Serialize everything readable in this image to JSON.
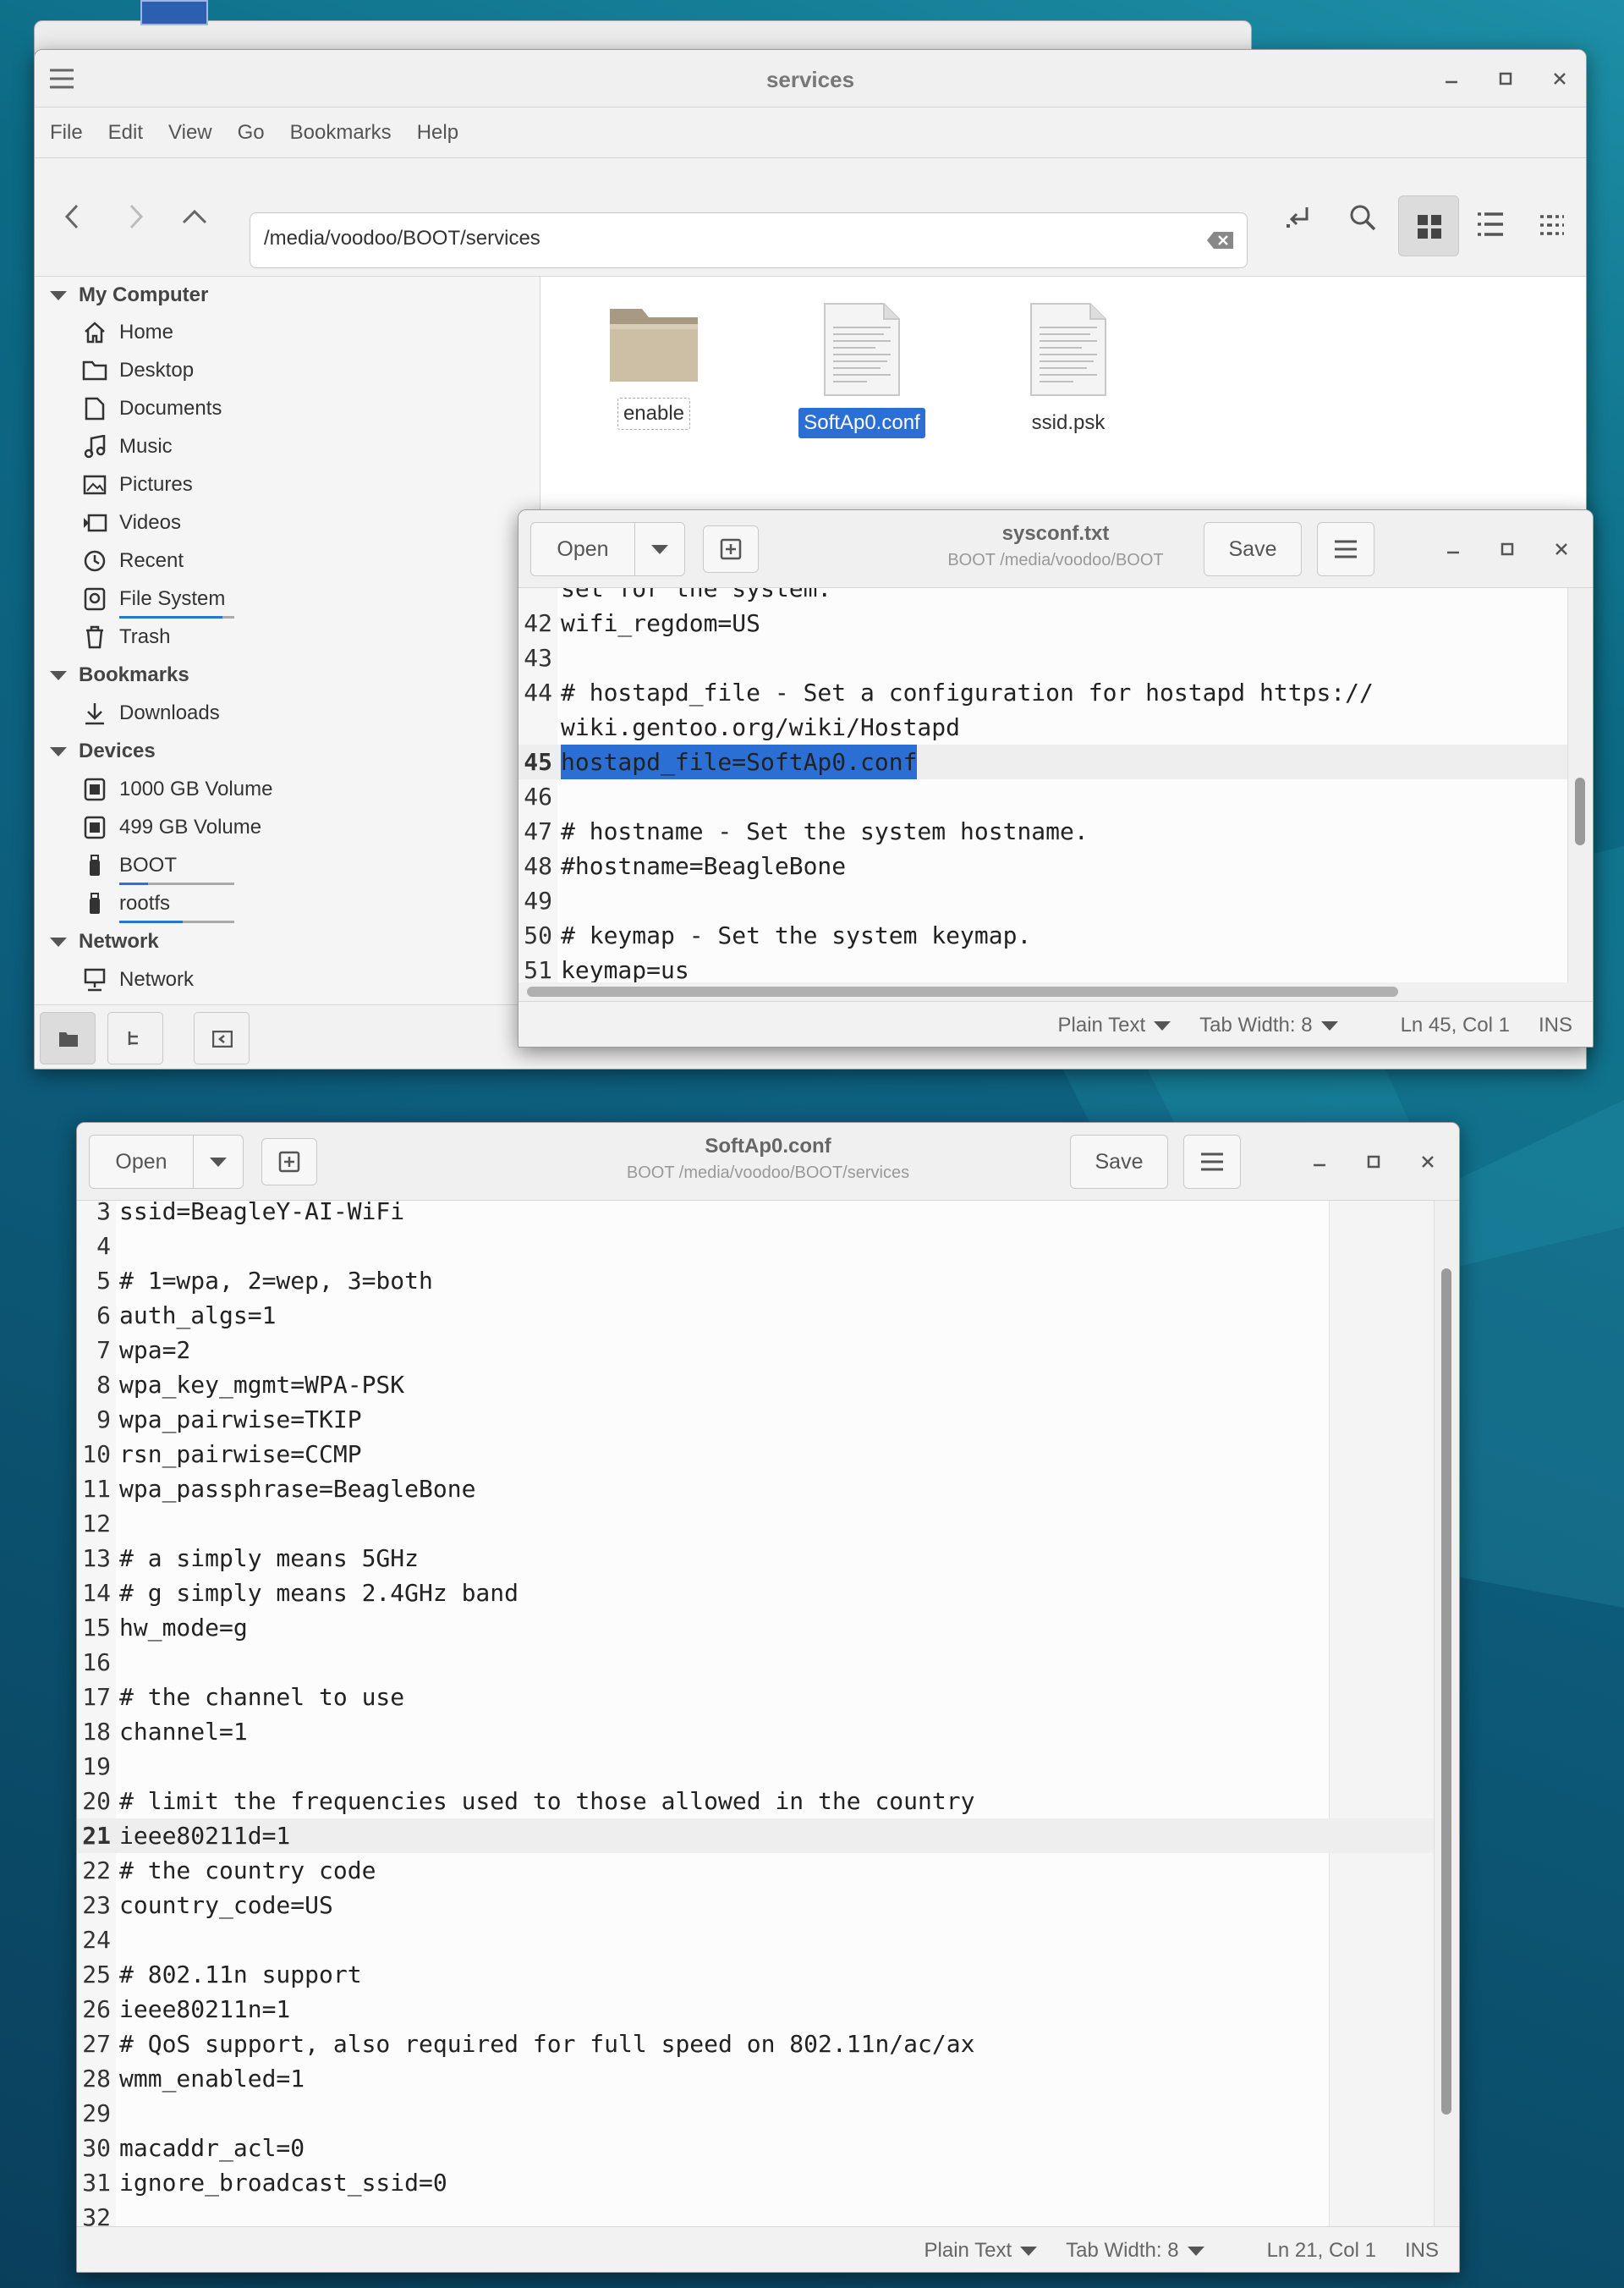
{
  "colors": {
    "accent": "#2b6fd4",
    "desktop": "#0d5f7e"
  },
  "file_manager": {
    "title": "services",
    "menu": [
      "File",
      "Edit",
      "View",
      "Go",
      "Bookmarks",
      "Help"
    ],
    "location": "/media/voodoo/BOOT/services",
    "sidebar": {
      "sections": [
        {
          "label": "My Computer",
          "items": [
            {
              "label": "Home",
              "icon": "home-icon"
            },
            {
              "label": "Desktop",
              "icon": "folder-icon"
            },
            {
              "label": "Documents",
              "icon": "document-icon"
            },
            {
              "label": "Music",
              "icon": "music-icon"
            },
            {
              "label": "Pictures",
              "icon": "picture-icon"
            },
            {
              "label": "Videos",
              "icon": "video-icon"
            },
            {
              "label": "Recent",
              "icon": "clock-icon"
            },
            {
              "label": "File System",
              "icon": "drive-icon",
              "usage": 0.9
            },
            {
              "label": "Trash",
              "icon": "trash-icon"
            }
          ]
        },
        {
          "label": "Bookmarks",
          "items": [
            {
              "label": "Downloads",
              "icon": "download-icon"
            }
          ]
        },
        {
          "label": "Devices",
          "items": [
            {
              "label": "1000 GB Volume",
              "icon": "drive-icon"
            },
            {
              "label": "499 GB Volume",
              "icon": "drive-icon"
            },
            {
              "label": "BOOT",
              "icon": "usb-icon",
              "usage": 0.25
            },
            {
              "label": "rootfs",
              "icon": "usb-icon",
              "usage": 0.55
            }
          ]
        },
        {
          "label": "Network",
          "items": [
            {
              "label": "Network",
              "icon": "network-icon"
            }
          ]
        }
      ]
    },
    "files": [
      {
        "name": "enable",
        "type": "folder"
      },
      {
        "name": "SoftAp0.conf",
        "type": "text",
        "selected": true
      },
      {
        "name": "ssid.psk",
        "type": "text"
      }
    ]
  },
  "sysconf_editor": {
    "title": "sysconf.txt",
    "subtitle": "BOOT /media/voodoo/BOOT",
    "open_label": "Open",
    "save_label": "Save",
    "partial_top": "set for the system.",
    "lines": [
      {
        "n": "42",
        "t": "wifi_regdom=US"
      },
      {
        "n": "43",
        "t": ""
      },
      {
        "n": "44",
        "t": "# hostapd_file - Set a configuration for hostapd https://"
      },
      {
        "n": "",
        "t": "wiki.gentoo.org/wiki/Hostapd"
      },
      {
        "n": "45",
        "t": "hostapd_file=SoftAp0.conf",
        "current": true,
        "selected": true
      },
      {
        "n": "46",
        "t": ""
      },
      {
        "n": "47",
        "t": "# hostname - Set the system hostname."
      },
      {
        "n": "48",
        "t": "#hostname=BeagleBone"
      },
      {
        "n": "49",
        "t": ""
      },
      {
        "n": "50",
        "t": "# keymap - Set the system keymap."
      },
      {
        "n": "51",
        "t": "keymap=us"
      }
    ],
    "status": {
      "syntax": "Plain Text",
      "tab_width": "Tab Width: 8",
      "position": "Ln 45, Col 1",
      "mode": "INS"
    }
  },
  "softap_editor": {
    "title": "SoftAp0.conf",
    "subtitle": "BOOT /media/voodoo/BOOT/services",
    "open_label": "Open",
    "save_label": "Save",
    "lines": [
      {
        "n": "3",
        "t": "ssid=BeagleY-AI-WiFi"
      },
      {
        "n": "4",
        "t": ""
      },
      {
        "n": "5",
        "t": "# 1=wpa, 2=wep, 3=both"
      },
      {
        "n": "6",
        "t": "auth_algs=1"
      },
      {
        "n": "7",
        "t": "wpa=2"
      },
      {
        "n": "8",
        "t": "wpa_key_mgmt=WPA-PSK"
      },
      {
        "n": "9",
        "t": "wpa_pairwise=TKIP"
      },
      {
        "n": "10",
        "t": "rsn_pairwise=CCMP"
      },
      {
        "n": "11",
        "t": "wpa_passphrase=BeagleBone"
      },
      {
        "n": "12",
        "t": ""
      },
      {
        "n": "13",
        "t": "# a simply means 5GHz"
      },
      {
        "n": "14",
        "t": "# g simply means 2.4GHz band"
      },
      {
        "n": "15",
        "t": "hw_mode=g"
      },
      {
        "n": "16",
        "t": ""
      },
      {
        "n": "17",
        "t": "# the channel to use"
      },
      {
        "n": "18",
        "t": "channel=1"
      },
      {
        "n": "19",
        "t": ""
      },
      {
        "n": "20",
        "t": "# limit the frequencies used to those allowed in the country"
      },
      {
        "n": "21",
        "t": "ieee80211d=1",
        "current": true
      },
      {
        "n": "22",
        "t": "# the country code"
      },
      {
        "n": "23",
        "t": "country_code=US"
      },
      {
        "n": "24",
        "t": ""
      },
      {
        "n": "25",
        "t": "# 802.11n support"
      },
      {
        "n": "26",
        "t": "ieee80211n=1"
      },
      {
        "n": "27",
        "t": "# QoS support, also required for full speed on 802.11n/ac/ax"
      },
      {
        "n": "28",
        "t": "wmm_enabled=1"
      },
      {
        "n": "29",
        "t": ""
      },
      {
        "n": "30",
        "t": "macaddr_acl=0"
      },
      {
        "n": "31",
        "t": "ignore_broadcast_ssid=0"
      },
      {
        "n": "32",
        "t": ""
      }
    ],
    "status": {
      "syntax": "Plain Text",
      "tab_width": "Tab Width: 8",
      "position": "Ln 21, Col 1",
      "mode": "INS"
    }
  }
}
